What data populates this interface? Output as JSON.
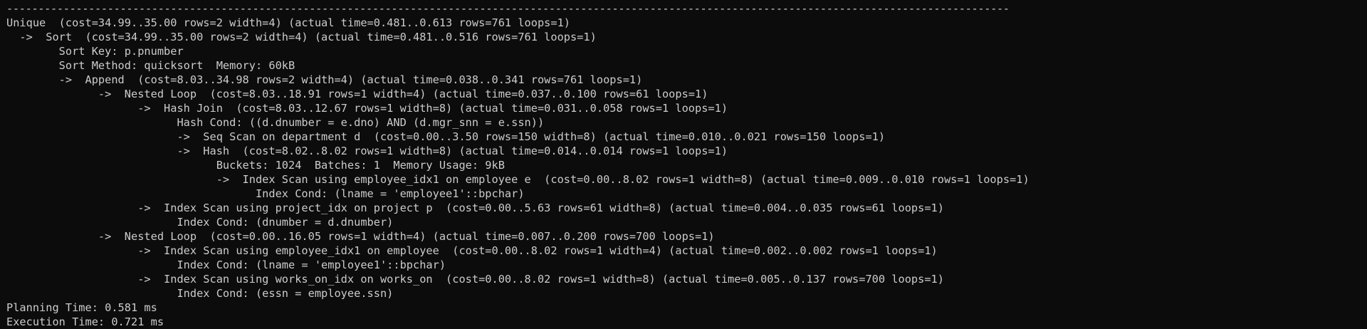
{
  "terminal": {
    "separator": "--------------------------------------------------------------------------------------------------------------------------------------------------------------------------------------------------------------------",
    "lines": [
      "Unique  (cost=34.99..35.00 rows=2 width=4) (actual time=0.481..0.613 rows=761 loops=1)",
      "  ->  Sort  (cost=34.99..35.00 rows=2 width=4) (actual time=0.481..0.516 rows=761 loops=1)",
      "        Sort Key: p.pnumber",
      "        Sort Method: quicksort  Memory: 60kB",
      "        ->  Append  (cost=8.03..34.98 rows=2 width=4) (actual time=0.038..0.341 rows=761 loops=1)",
      "              ->  Nested Loop  (cost=8.03..18.91 rows=1 width=4) (actual time=0.037..0.100 rows=61 loops=1)",
      "                    ->  Hash Join  (cost=8.03..12.67 rows=1 width=8) (actual time=0.031..0.058 rows=1 loops=1)",
      "                          Hash Cond: ((d.dnumber = e.dno) AND (d.mgr_snn = e.ssn))",
      "                          ->  Seq Scan on department d  (cost=0.00..3.50 rows=150 width=8) (actual time=0.010..0.021 rows=150 loops=1)",
      "                          ->  Hash  (cost=8.02..8.02 rows=1 width=8) (actual time=0.014..0.014 rows=1 loops=1)",
      "                                Buckets: 1024  Batches: 1  Memory Usage: 9kB",
      "                                ->  Index Scan using employee_idx1 on employee e  (cost=0.00..8.02 rows=1 width=8) (actual time=0.009..0.010 rows=1 loops=1)",
      "                                      Index Cond: (lname = 'employee1'::bpchar)",
      "                    ->  Index Scan using project_idx on project p  (cost=0.00..5.63 rows=61 width=8) (actual time=0.004..0.035 rows=61 loops=1)",
      "                          Index Cond: (dnumber = d.dnumber)",
      "              ->  Nested Loop  (cost=0.00..16.05 rows=1 width=4) (actual time=0.007..0.200 rows=700 loops=1)",
      "                    ->  Index Scan using employee_idx1 on employee  (cost=0.00..8.02 rows=1 width=4) (actual time=0.002..0.002 rows=1 loops=1)",
      "                          Index Cond: (lname = 'employee1'::bpchar)",
      "                    ->  Index Scan using works_on_idx on works_on  (cost=0.00..8.02 rows=1 width=8) (actual time=0.005..0.137 rows=700 loops=1)",
      "                          Index Cond: (essn = employee.ssn)",
      "Planning Time: 0.581 ms",
      "Execution Time: 0.721 ms"
    ]
  }
}
